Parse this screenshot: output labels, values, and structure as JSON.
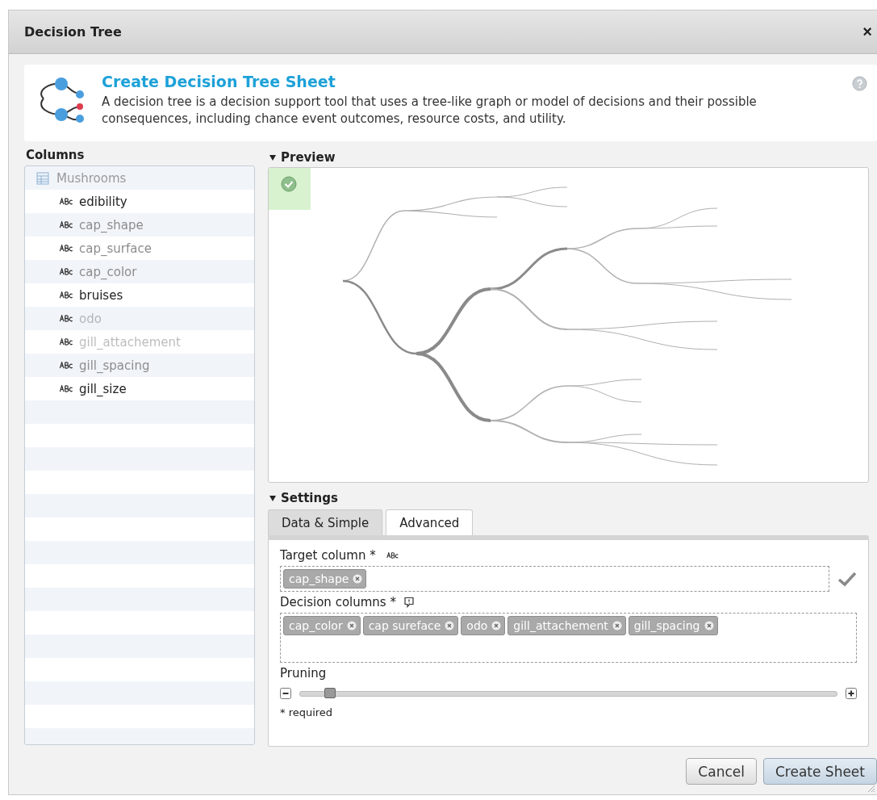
{
  "window": {
    "title": "Decision Tree",
    "close": "×"
  },
  "header": {
    "title": "Create Decision Tree Sheet",
    "description": "A decision tree is a decision support tool that uses a tree-like graph or model of decisions and their possible consequences, including chance event outcomes, resource costs, and utility."
  },
  "columns": {
    "heading": "Columns",
    "table": "Mushrooms",
    "items": [
      {
        "name": "edibility",
        "used": false,
        "disabled": false
      },
      {
        "name": "cap_shape",
        "used": true,
        "disabled": false
      },
      {
        "name": "cap_surface",
        "used": true,
        "disabled": false
      },
      {
        "name": "cap_color",
        "used": true,
        "disabled": false
      },
      {
        "name": "bruises",
        "used": false,
        "disabled": false
      },
      {
        "name": "odo",
        "used": false,
        "disabled": true
      },
      {
        "name": "gill_attachement",
        "used": false,
        "disabled": true
      },
      {
        "name": "gill_spacing",
        "used": true,
        "disabled": false
      },
      {
        "name": "gill_size",
        "used": false,
        "disabled": false
      }
    ]
  },
  "preview": {
    "heading": "Preview",
    "expanded": true,
    "valid": true
  },
  "settings": {
    "heading": "Settings",
    "expanded": true,
    "tabs": [
      {
        "label": "Data & Simple",
        "selected": true
      },
      {
        "label": "Advanced",
        "selected": false
      }
    ],
    "target": {
      "label": "Target column *",
      "tags": [
        "cap_shape"
      ],
      "valid": true
    },
    "decision": {
      "label": "Decision columns *",
      "tags": [
        "cap_color",
        "cap sureface",
        "odo",
        "gill_attachement",
        "gill_spacing"
      ]
    },
    "pruning": {
      "label": "Pruning",
      "level": 0.055
    },
    "note": "* required"
  },
  "buttons": [
    {
      "label": "Cancel",
      "kind": "secondary"
    },
    {
      "label": "Create Sheet",
      "kind": "primary"
    }
  ]
}
